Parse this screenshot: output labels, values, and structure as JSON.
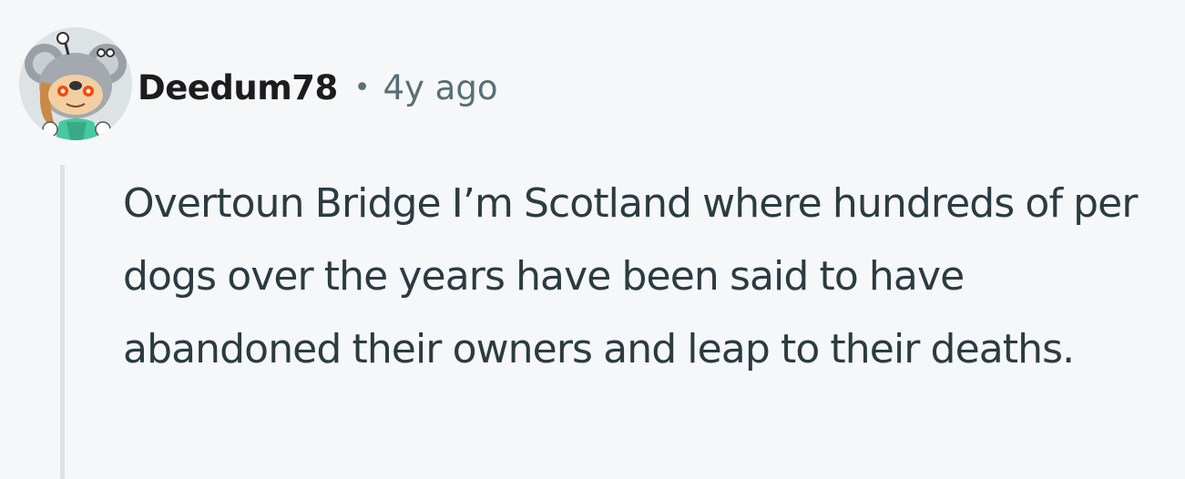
{
  "comment": {
    "author": "Deedum78",
    "separator": "•",
    "timestamp": "4y ago",
    "body": "Overtoun Bridge I’m Scotland where hundreds of per dogs over the years have been said to have abandoned their owners and leap to their deaths.",
    "avatar_icon": "koala-snoo-avatar"
  },
  "colors": {
    "background": "#f6f7f8",
    "author_text": "#1c1c1c",
    "meta_text": "#576f76",
    "body_text": "#2a3c42",
    "thread_line": "#dfe3e6"
  }
}
